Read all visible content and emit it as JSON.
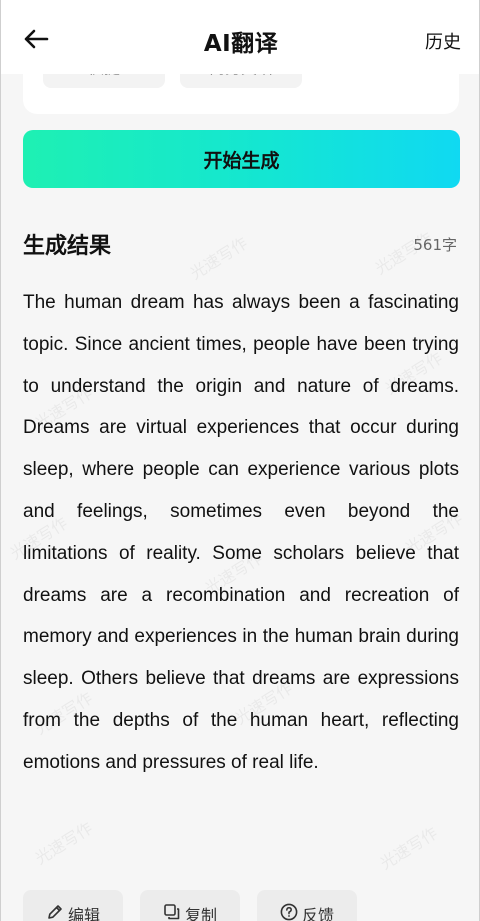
{
  "header": {
    "title": "AI翻译",
    "history_label": "历史"
  },
  "icons": {
    "back": "arrow-left-icon",
    "edit": "pencil-icon",
    "copy": "copy-icon",
    "feedback": "question-circle-icon"
  },
  "options": {
    "chips": [
      "快捷",
      "商务英语"
    ]
  },
  "generate_button": {
    "label": "开始生成",
    "gradient": [
      "#1ef0b3",
      "#10d9f2"
    ]
  },
  "result": {
    "title": "生成结果",
    "char_count": "561字",
    "text": "The human dream has always been a fascinating topic. Since ancient times, people have been trying to understand the origin and nature of dreams. Dreams are virtual experiences that occur during sleep, where people can experience various plots and feelings, sometimes even beyond the limitations of reality. Some scholars believe that dreams are a recombination and recreation of memory and experiences in the human brain during sleep. Others believe that dreams are expressions from the depths of the human heart, reflecting emotions and pressures of real life."
  },
  "actions": {
    "edit_label": "编辑",
    "copy_label": "复制",
    "feedback_label": "反馈"
  },
  "watermark": {
    "text": "光速写作"
  }
}
